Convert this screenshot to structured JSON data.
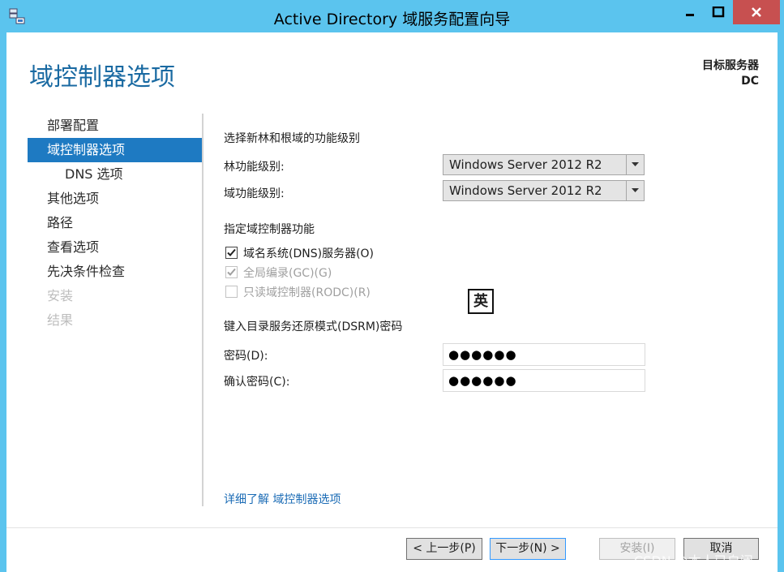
{
  "window": {
    "title": "Active Directory 域服务配置向导"
  },
  "header": {
    "page_title": "域控制器选项",
    "target_label": "目标服务器",
    "target_server": "DC"
  },
  "nav": {
    "items": [
      {
        "label": "部署配置",
        "state": "normal"
      },
      {
        "label": "域控制器选项",
        "state": "active"
      },
      {
        "label": "DNS 选项",
        "state": "sub"
      },
      {
        "label": "其他选项",
        "state": "normal"
      },
      {
        "label": "路径",
        "state": "normal"
      },
      {
        "label": "查看选项",
        "state": "normal"
      },
      {
        "label": "先决条件检查",
        "state": "normal"
      },
      {
        "label": "安装",
        "state": "disabled"
      },
      {
        "label": "结果",
        "state": "disabled"
      }
    ]
  },
  "functional_level": {
    "section_title": "选择新林和根域的功能级别",
    "forest_label": "林功能级别:",
    "forest_value": "Windows Server 2012 R2",
    "domain_label": "域功能级别:",
    "domain_value": "Windows Server 2012 R2"
  },
  "capabilities": {
    "section_title": "指定域控制器功能",
    "dns_label": "域名系统(DNS)服务器(O)",
    "dns_checked": true,
    "gc_label": "全局编录(GC)(G)",
    "gc_checked": true,
    "rodc_label": "只读域控制器(RODC)(R)",
    "rodc_checked": false
  },
  "ime_indicator": "英",
  "dsrm": {
    "section_title": "键入目录服务还原模式(DSRM)密码",
    "password_label": "密码(D):",
    "password_value": "●●●●●●",
    "confirm_label": "确认密码(C):",
    "confirm_value": "●●●●●●"
  },
  "more_link": "详细了解 域控制器选项",
  "footer": {
    "prev": "< 上一步(P)",
    "next": "下一步(N) >",
    "install": "安装(I)",
    "cancel": "取消"
  },
  "watermark": "CSDN @本人已自闭",
  "colors": {
    "title_bar": "#5bc4ee",
    "accent": "#1e7ac2",
    "heading": "#1a6aa2",
    "link": "#1a6bb5"
  }
}
